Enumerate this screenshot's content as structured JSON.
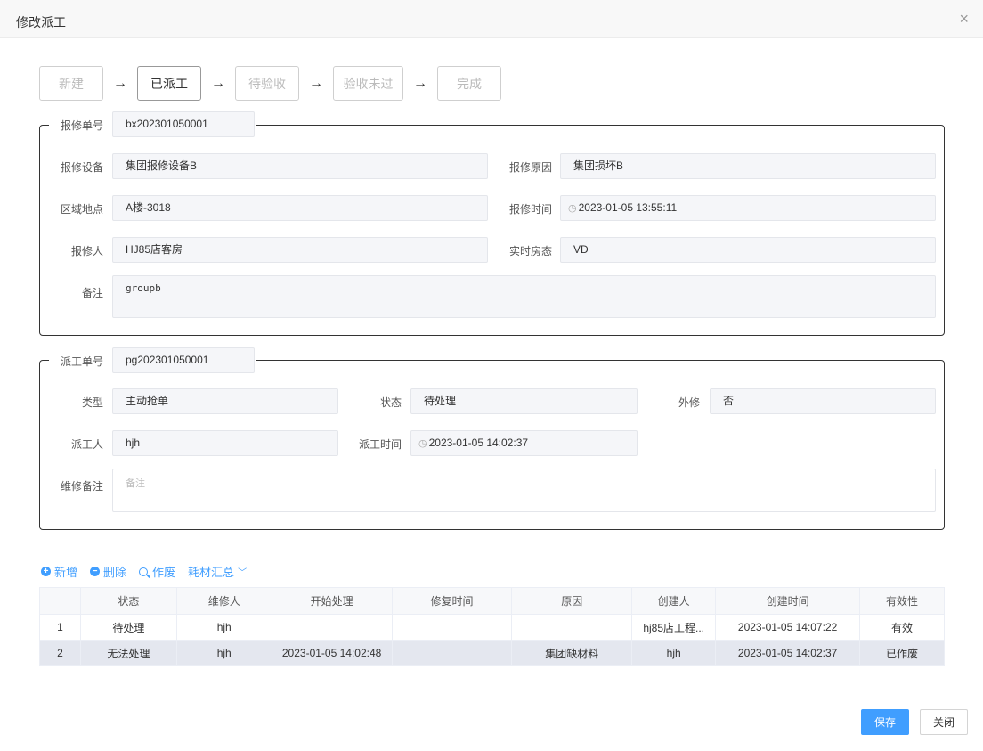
{
  "dialog": {
    "title": "修改派工",
    "close_glyph": "×"
  },
  "steps": [
    {
      "label": "新建",
      "active": false
    },
    {
      "label": "已派工",
      "active": true
    },
    {
      "label": "待验收",
      "active": false
    },
    {
      "label": "验收未过",
      "active": false
    },
    {
      "label": "完成",
      "active": false
    }
  ],
  "repair": {
    "order_no_label": "报修单号",
    "order_no": "bx202301050001",
    "device_label": "报修设备",
    "device": "集团报修设备B",
    "reason_label": "报修原因",
    "reason": "集团损坏B",
    "location_label": "区域地点",
    "location": "A楼-3018",
    "time_label": "报修时间",
    "time": "2023-01-05 13:55:11",
    "reporter_label": "报修人",
    "reporter": "HJ85店客房",
    "room_status_label": "实时房态",
    "room_status": "VD",
    "remark_label": "备注",
    "remark": "groupb"
  },
  "dispatch": {
    "order_no_label": "派工单号",
    "order_no": "pg202301050001",
    "type_label": "类型",
    "type": "主动抢单",
    "status_label": "状态",
    "status": "待处理",
    "outsource_label": "外修",
    "outsource": "否",
    "worker_label": "派工人",
    "worker": "hjh",
    "time_label": "派工时间",
    "time": "2023-01-05 14:02:37",
    "remark_label": "维修备注",
    "remark_placeholder": "备注"
  },
  "toolbar": {
    "add": "新增",
    "delete": "删除",
    "void": "作废",
    "summary": "耗材汇总"
  },
  "table": {
    "headers": [
      "",
      "状态",
      "维修人",
      "开始处理",
      "修复时间",
      "原因",
      "创建人",
      "创建时间",
      "有效性"
    ],
    "rows": [
      [
        "1",
        "待处理",
        "hjh",
        "",
        "",
        "",
        "hj85店工程...",
        "2023-01-05 14:07:22",
        "有效"
      ],
      [
        "2",
        "无法处理",
        "hjh",
        "2023-01-05 14:02:48",
        "",
        "集团缺材料",
        "hjh",
        "2023-01-05 14:02:37",
        "已作废"
      ]
    ]
  },
  "footer": {
    "save": "保存",
    "close": "关闭"
  },
  "colors": {
    "primary": "#409eff",
    "selected_row": "#e4e7ef",
    "input_bg": "#f5f6f9"
  }
}
